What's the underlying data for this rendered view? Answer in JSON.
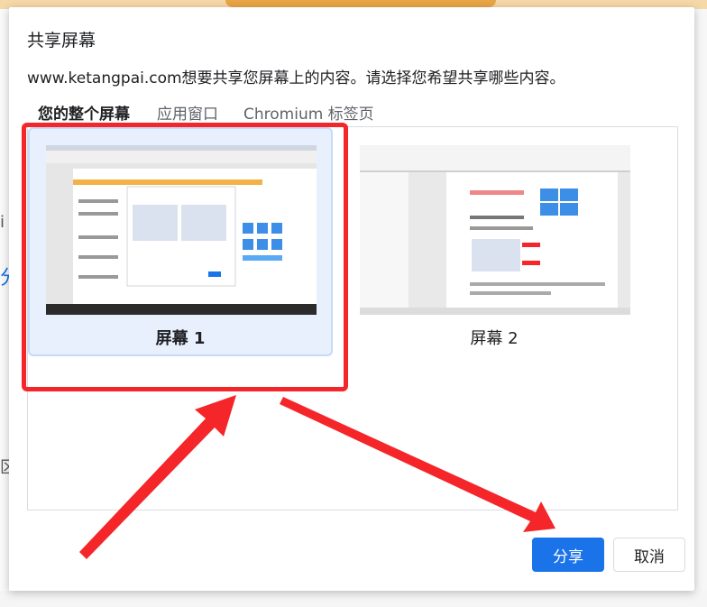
{
  "dialog": {
    "title": "共享屏幕",
    "description": "www.ketangpai.com想要共享您屏幕上的内容。请选择您希望共享哪些内容。"
  },
  "tabs": [
    {
      "label": "您的整个屏幕",
      "active": true
    },
    {
      "label": "应用窗口",
      "active": false
    },
    {
      "label": "Chromium 标签页",
      "active": false
    }
  ],
  "screens": [
    {
      "label": "屏幕 1",
      "selected": true
    },
    {
      "label": "屏幕 2",
      "selected": false
    }
  ],
  "buttons": {
    "share": "分享",
    "cancel": "取消"
  },
  "background": {
    "left_glyphs": [
      "i",
      "分",
      "区"
    ]
  },
  "colors": {
    "primary": "#1a73e8",
    "annotation_red": "#f5262a",
    "selected_bg": "#e8f0fe"
  }
}
